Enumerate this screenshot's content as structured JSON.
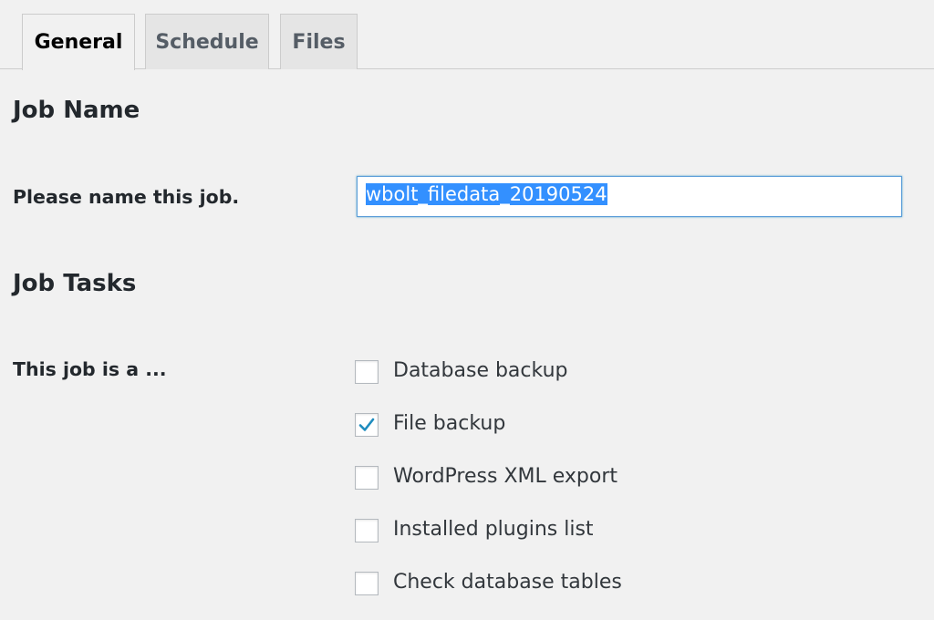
{
  "tabs": [
    {
      "label": "General",
      "active": true
    },
    {
      "label": "Schedule",
      "active": false
    },
    {
      "label": "Files",
      "active": false
    }
  ],
  "job_name": {
    "heading": "Job Name",
    "label": "Please name this job.",
    "value": "wbolt_filedata_20190524"
  },
  "job_tasks": {
    "heading": "Job Tasks",
    "label": "This job is a ...",
    "tasks": [
      {
        "label": "Database backup",
        "checked": false
      },
      {
        "label": "File backup",
        "checked": true
      },
      {
        "label": "WordPress XML export",
        "checked": false
      },
      {
        "label": "Installed plugins list",
        "checked": false
      },
      {
        "label": "Check database tables",
        "checked": false
      }
    ]
  },
  "colors": {
    "background": "#f1f1f1",
    "checkmark": "#1e8cbe",
    "selection": "#3390ff",
    "input_focus_border": "#5b9dd9"
  }
}
